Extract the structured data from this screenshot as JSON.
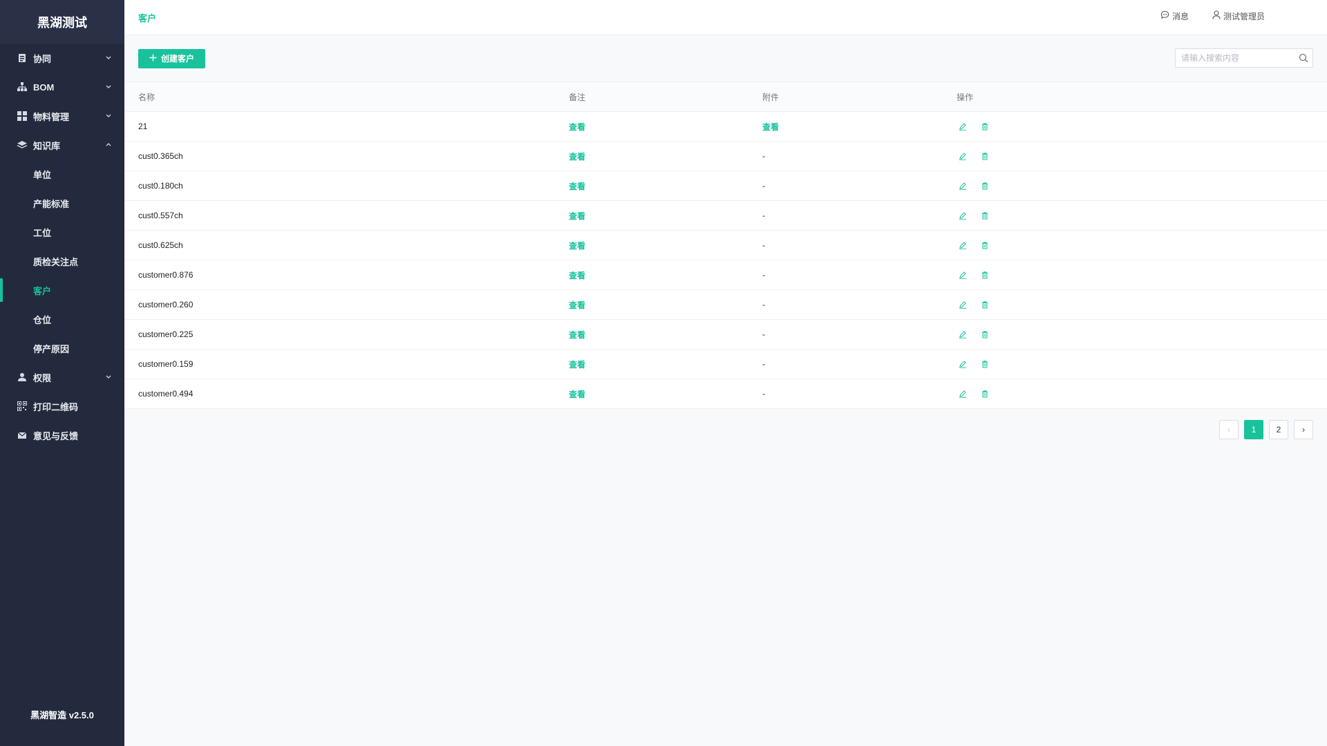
{
  "app": {
    "brand": "黑湖测试",
    "version": "黑湖智造 v2.5.0"
  },
  "sidebar": {
    "items": [
      {
        "label": "协同",
        "icon": "clipboard-icon",
        "expanded": false
      },
      {
        "label": "BOM",
        "icon": "hierarchy-icon",
        "expanded": false
      },
      {
        "label": "物料管理",
        "icon": "grid-icon",
        "expanded": false
      },
      {
        "label": "知识库",
        "icon": "layers-icon",
        "expanded": true,
        "children": [
          "单位",
          "产能标准",
          "工位",
          "质检关注点",
          "客户",
          "仓位",
          "停产原因"
        ]
      },
      {
        "label": "权限",
        "icon": "user-icon",
        "expanded": false
      },
      {
        "label": "打印二维码",
        "icon": "qrcode-icon"
      },
      {
        "label": "意见与反馈",
        "icon": "mail-icon"
      }
    ],
    "active_child": "客户"
  },
  "header": {
    "title": "客户",
    "messages": "消息",
    "user": "测试管理员"
  },
  "toolbar": {
    "create_label": "创建客户",
    "search_placeholder": "请输入搜索内容"
  },
  "table": {
    "columns": [
      "名称",
      "备注",
      "附件",
      "操作"
    ],
    "rows": [
      {
        "name": "21",
        "note": "查看",
        "attachment": "查看"
      },
      {
        "name": "cust0.365ch",
        "note": "查看",
        "attachment": "-"
      },
      {
        "name": "cust0.180ch",
        "note": "查看",
        "attachment": "-"
      },
      {
        "name": "cust0.557ch",
        "note": "查看",
        "attachment": "-"
      },
      {
        "name": "cust0.625ch",
        "note": "查看",
        "attachment": "-"
      },
      {
        "name": "customer0.876",
        "note": "查看",
        "attachment": "-"
      },
      {
        "name": "customer0.260",
        "note": "查看",
        "attachment": "-"
      },
      {
        "name": "customer0.225",
        "note": "查看",
        "attachment": "-"
      },
      {
        "name": "customer0.159",
        "note": "查看",
        "attachment": "-"
      },
      {
        "name": "customer0.494",
        "note": "查看",
        "attachment": "-"
      }
    ]
  },
  "pagination": {
    "prev": "‹",
    "pages": [
      "1",
      "2"
    ],
    "current": "1",
    "next": "›"
  },
  "colors": {
    "accent": "#18c29c",
    "sidebar_bg": "#232a3d"
  }
}
